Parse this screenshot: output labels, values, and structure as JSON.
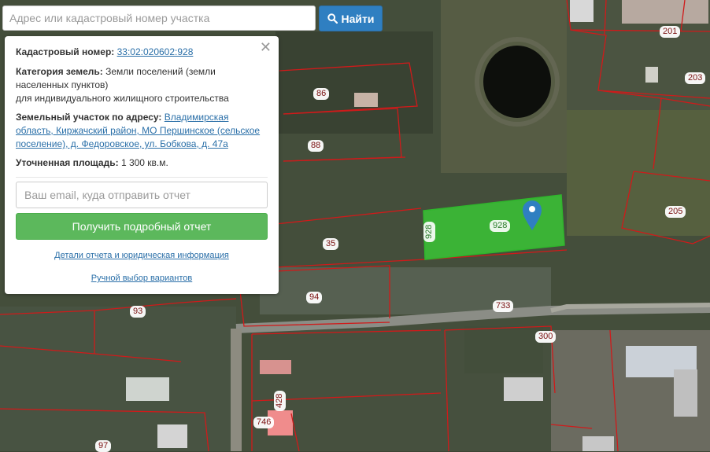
{
  "search": {
    "placeholder": "Адрес или кадастровый номер участка",
    "button_label": "Найти"
  },
  "panel": {
    "cadastral_label": "Кадастровый номер:",
    "cadastral_number": "33:02:020602:928",
    "category_label": "Категория земель:",
    "category_value": "Земли поселений (земли населенных пунктов)",
    "category_use": "для индивидуального жилищного строительства",
    "address_label": "Земельный участок по адресу:",
    "address_value": "Владимирская область, Киржачский район, МО Першинское (сельское поселение), д. Федоровское, ул. Бобкова, д. 47а",
    "area_label": "Уточненная площадь:",
    "area_value": "1 300 кв.м.",
    "email_placeholder": "Ваш email, куда отправить отчет",
    "report_button": "Получить подробный отчет",
    "details_link": "Детали отчета и юридическая информация",
    "manual_link": "Ручной выбор вариантов",
    "close_symbol": "✕"
  },
  "map": {
    "highlight_color": "#39c636",
    "boundary_color": "#d01a1a",
    "selected_parcel_label": "928",
    "selected_parcel_side_label": "928",
    "parcel_labels": [
      "201",
      "203",
      "86",
      "88",
      "35",
      "94",
      "93",
      "733",
      "300",
      "205",
      "746",
      "428",
      "97"
    ]
  }
}
